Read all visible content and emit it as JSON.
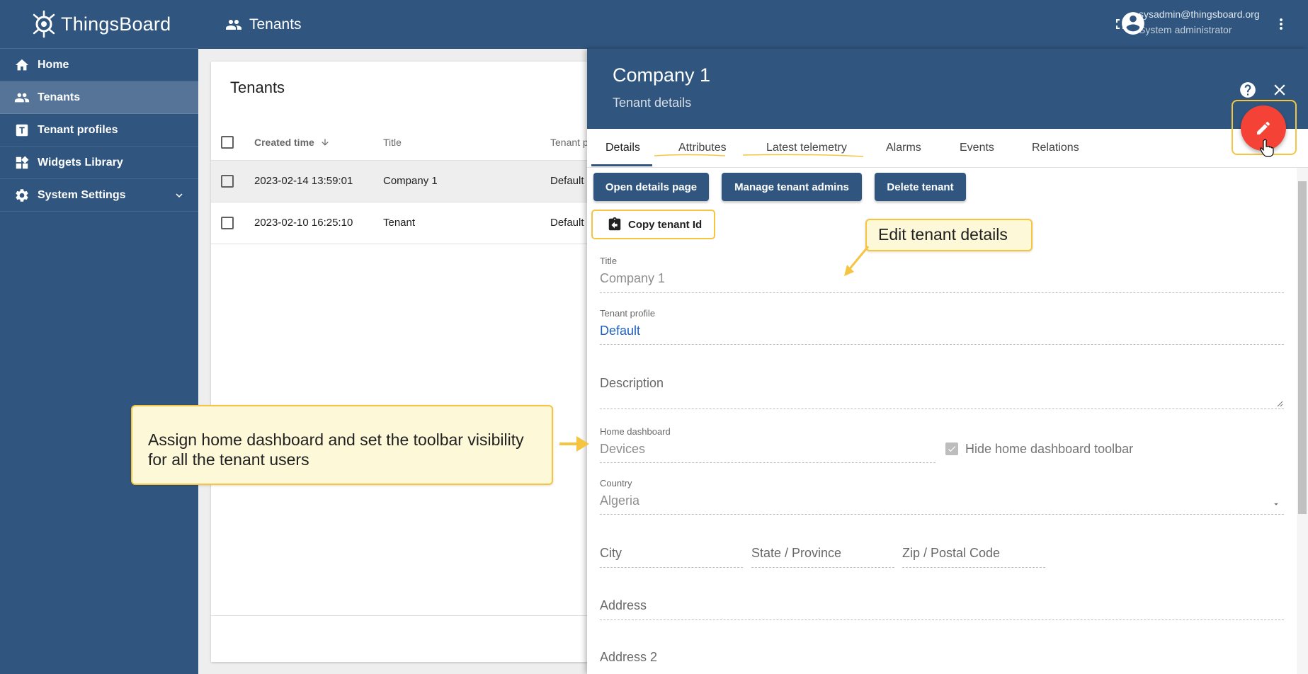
{
  "app": {
    "name": "ThingsBoard"
  },
  "sidebar": {
    "items": [
      {
        "label": "Home",
        "icon": "home-icon"
      },
      {
        "label": "Tenants",
        "icon": "people-icon",
        "active": true
      },
      {
        "label": "Tenant profiles",
        "icon": "tenant-profile-icon"
      },
      {
        "label": "Widgets Library",
        "icon": "widgets-icon"
      },
      {
        "label": "System Settings",
        "icon": "gear-icon",
        "expandable": true
      }
    ]
  },
  "topbar": {
    "title": "Tenants",
    "user_email": "sysadmin@thingsboard.org",
    "user_role": "System administrator"
  },
  "tenants_table": {
    "title": "Tenants",
    "columns": [
      "Created time",
      "Title",
      "Tenant p"
    ],
    "rows": [
      {
        "created": "2023-02-14 13:59:01",
        "title": "Company 1",
        "profile": "Default",
        "selected": true
      },
      {
        "created": "2023-02-10 16:25:10",
        "title": "Tenant",
        "profile": "Default",
        "selected": false
      }
    ]
  },
  "details": {
    "title": "Company 1",
    "subtitle": "Tenant details",
    "tabs": [
      "Details",
      "Attributes",
      "Latest telemetry",
      "Alarms",
      "Events",
      "Relations"
    ],
    "buttons": {
      "open_details": "Open details page",
      "manage_admins": "Manage tenant admins",
      "delete": "Delete tenant",
      "copy_id": "Copy tenant Id"
    },
    "fields": {
      "title_label": "Title",
      "title_value": "Company 1",
      "profile_label": "Tenant profile",
      "profile_value": "Default",
      "description_placeholder": "Description",
      "home_dashboard_label": "Home dashboard",
      "home_dashboard_value": "Devices",
      "hide_toolbar_label": "Hide home dashboard toolbar",
      "hide_toolbar_checked": true,
      "country_label": "Country",
      "country_value": "Algeria",
      "city_placeholder": "City",
      "state_placeholder": "State / Province",
      "zip_placeholder": "Zip / Postal Code",
      "address_placeholder": "Address",
      "address2_placeholder": "Address 2"
    }
  },
  "callouts": {
    "edit": "Edit tenant details",
    "assign_line1": "Assign home dashboard and set the toolbar visibility",
    "assign_line2": "for all  the tenant users"
  },
  "colors": {
    "primary": "#305680",
    "fab": "#f44336",
    "highlight": "#f5c542",
    "callout_bg": "#fdf9d8",
    "link": "#1f5fbf"
  }
}
